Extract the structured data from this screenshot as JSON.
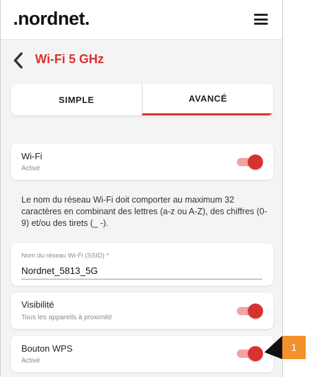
{
  "header": {
    "logo": ".nordnet.",
    "menu_icon": "hamburger-menu-icon"
  },
  "page": {
    "back_icon": "chevron-left-icon",
    "title": "Wi-Fi 5 GHz"
  },
  "tabs": [
    {
      "label": "SIMPLE",
      "active": false
    },
    {
      "label": "AVANCÉ",
      "active": true
    }
  ],
  "wifi": {
    "title": "Wi-Fi",
    "status": "Activé",
    "enabled": true
  },
  "info_text": "Le nom du réseau Wi-Fi doit comporter au maximum 32 caractères en combinant des lettres (a-z ou A-Z), des chiffres (0-9) et/ou des tirets (_ -).",
  "ssid": {
    "label": "Nom du réseau Wi-Fi (SSID) *",
    "value": "Nordnet_5813_5G"
  },
  "visibility": {
    "title": "Visibilité",
    "status": "Tous les appareils à proximité",
    "enabled": true
  },
  "wps": {
    "title": "Bouton WPS",
    "status": "Activé",
    "enabled": true
  },
  "callout": {
    "number": "1",
    "color": "#f0912b"
  },
  "colors": {
    "accent": "#d8322f",
    "toggle_track": "#f3a3a3"
  }
}
